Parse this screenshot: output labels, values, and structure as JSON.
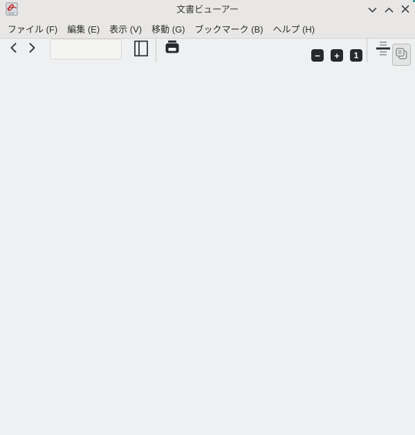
{
  "titlebar": {
    "title": "文書ビューアー"
  },
  "menubar": {
    "items": [
      {
        "label": "ファイル (F)"
      },
      {
        "label": "編集 (E)"
      },
      {
        "label": "表示 (V)"
      },
      {
        "label": "移動 (G)"
      },
      {
        "label": "ブックマーク (B)"
      },
      {
        "label": "ヘルプ (H)"
      }
    ]
  },
  "toolbar": {
    "page_number": {
      "value": ""
    },
    "page_total": {
      "value": ""
    },
    "zoom_out_glyph": "−",
    "zoom_in_glyph": "+",
    "zoom_reset_label": "1"
  },
  "colors": {
    "titlebar_bg": "#e8e7e5",
    "surface_bg": "#eff0f1",
    "dark_button_bg": "#26292d",
    "icon_dark": "#2b2e31",
    "icon_gray": "#a0a1a2",
    "accent_red": "#c32222",
    "corner_artifact": "#2e9b99"
  }
}
